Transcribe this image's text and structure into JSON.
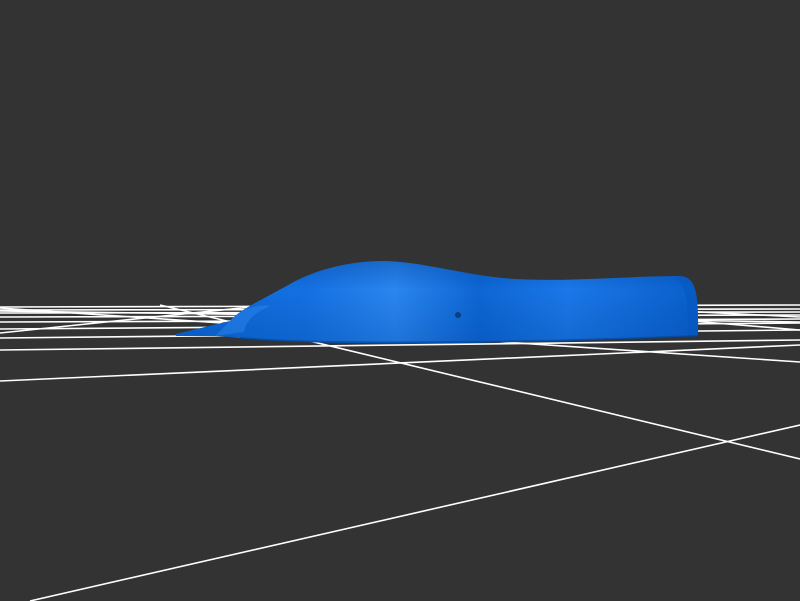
{
  "viewer": {
    "background_color": "#333333",
    "grid_color": "#ffffff",
    "model_color": "#0a66d6",
    "model_highlight_color": "#2f8cf2",
    "model_shadow_color": "#0550ad"
  }
}
